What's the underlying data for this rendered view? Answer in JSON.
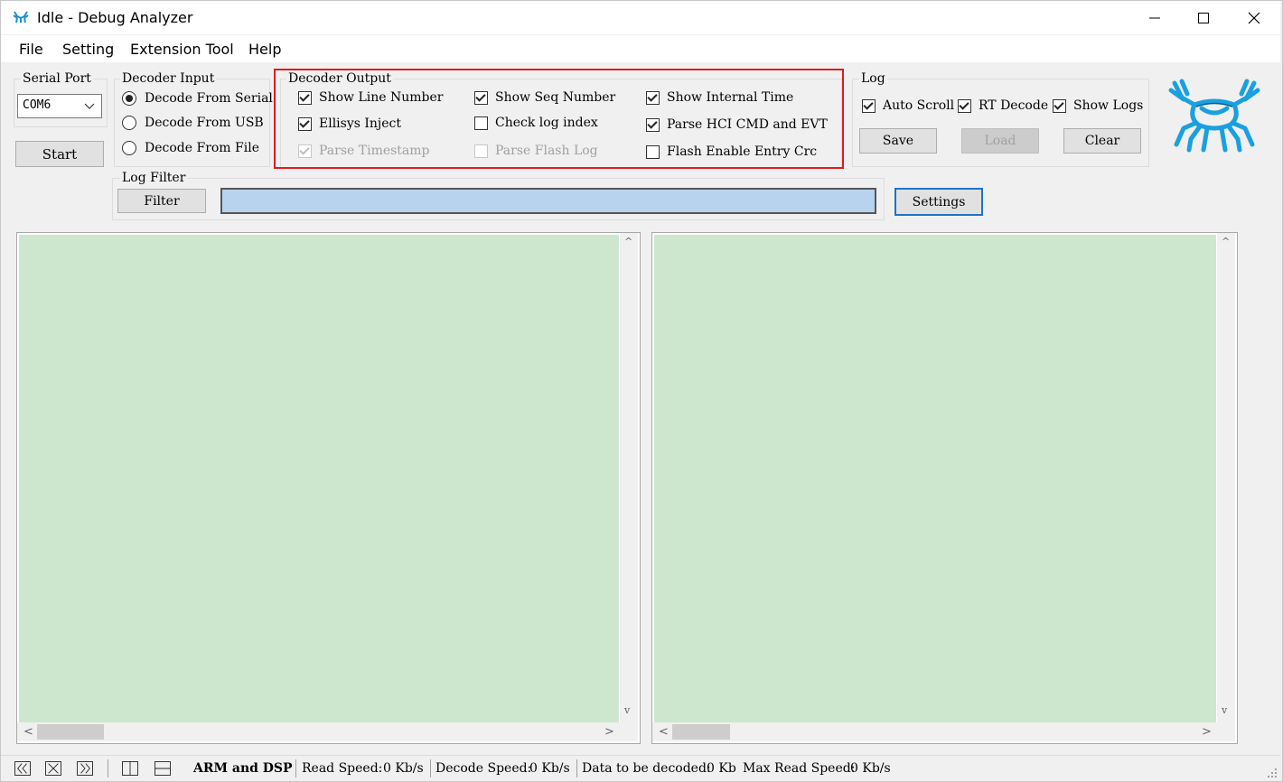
{
  "window": {
    "title": "Idle - Debug Analyzer"
  },
  "menu": [
    "File",
    "Setting",
    "Extension Tool",
    "Help"
  ],
  "serial_port": {
    "label": "Serial Port",
    "selected": "COM6",
    "start_label": "Start"
  },
  "decoder_input": {
    "label": "Decoder Input",
    "options": [
      "Decode From Serial",
      "Decode From USB",
      "Decode From File"
    ],
    "selected": "Decode From Serial"
  },
  "decoder_output": {
    "label": "Decoder Output",
    "options": [
      {
        "label": "Show Line Number",
        "checked": true,
        "enabled": true
      },
      {
        "label": "Ellisys Inject",
        "checked": true,
        "enabled": true
      },
      {
        "label": "Parse Timestamp",
        "checked": true,
        "enabled": false
      },
      {
        "label": "Show Seq Number",
        "checked": true,
        "enabled": true
      },
      {
        "label": "Check log index",
        "checked": false,
        "enabled": true
      },
      {
        "label": "Parse Flash Log",
        "checked": false,
        "enabled": false
      },
      {
        "label": "Show Internal Time",
        "checked": true,
        "enabled": true
      },
      {
        "label": "Parse HCI CMD and EVT",
        "checked": true,
        "enabled": true
      },
      {
        "label": "Flash Enable Entry Crc",
        "checked": false,
        "enabled": true
      }
    ],
    "highlight_color": "#e31b1b"
  },
  "log": {
    "label": "Log",
    "options": [
      {
        "label": "Auto Scroll",
        "checked": true
      },
      {
        "label": "RT Decode",
        "checked": true
      },
      {
        "label": "Show Logs",
        "checked": true
      }
    ],
    "save_label": "Save",
    "load_label": "Load",
    "clear_label": "Clear"
  },
  "log_filter": {
    "label": "Log Filter",
    "filter_label": "Filter",
    "input_value": "",
    "settings_label": "Settings"
  },
  "logo": {
    "icon": "realtek-crab-logo-icon",
    "color": "#1aa0e0"
  },
  "panes": {
    "background": "#cde7cf"
  },
  "status_bar": {
    "mode": "ARM and DSP",
    "read_speed_label": "Read Speed:",
    "read_speed_value": "0 Kb/s",
    "decode_speed_label": "Decode Speed:",
    "decode_speed_value": "0 Kb/s",
    "data_label": "Data to be decoded:",
    "data_value": "0 Kb",
    "max_read_label": "Max Read Speed:",
    "max_read_value": "0 Kb/s"
  }
}
